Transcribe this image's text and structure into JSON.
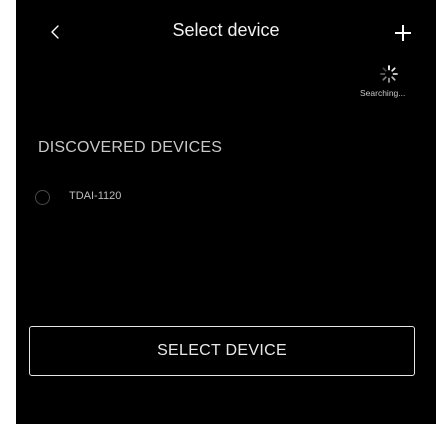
{
  "header": {
    "title": "Select device",
    "back_icon": "chevron-left-icon",
    "add_icon": "plus-icon"
  },
  "status": {
    "searching_label": "Searching...",
    "spinner_icon": "spinner-icon"
  },
  "discovered": {
    "section_title": "DISCOVERED DEVICES",
    "devices": [
      {
        "label": "TDAI-1120",
        "selected": false
      }
    ]
  },
  "actions": {
    "select_label": "SELECT DEVICE"
  },
  "colors": {
    "background": "#000000",
    "text": "#ffffff",
    "muted_text": "#c9c9c9",
    "radio_border": "#4a4a4a",
    "button_border": "#e6e6e6"
  }
}
